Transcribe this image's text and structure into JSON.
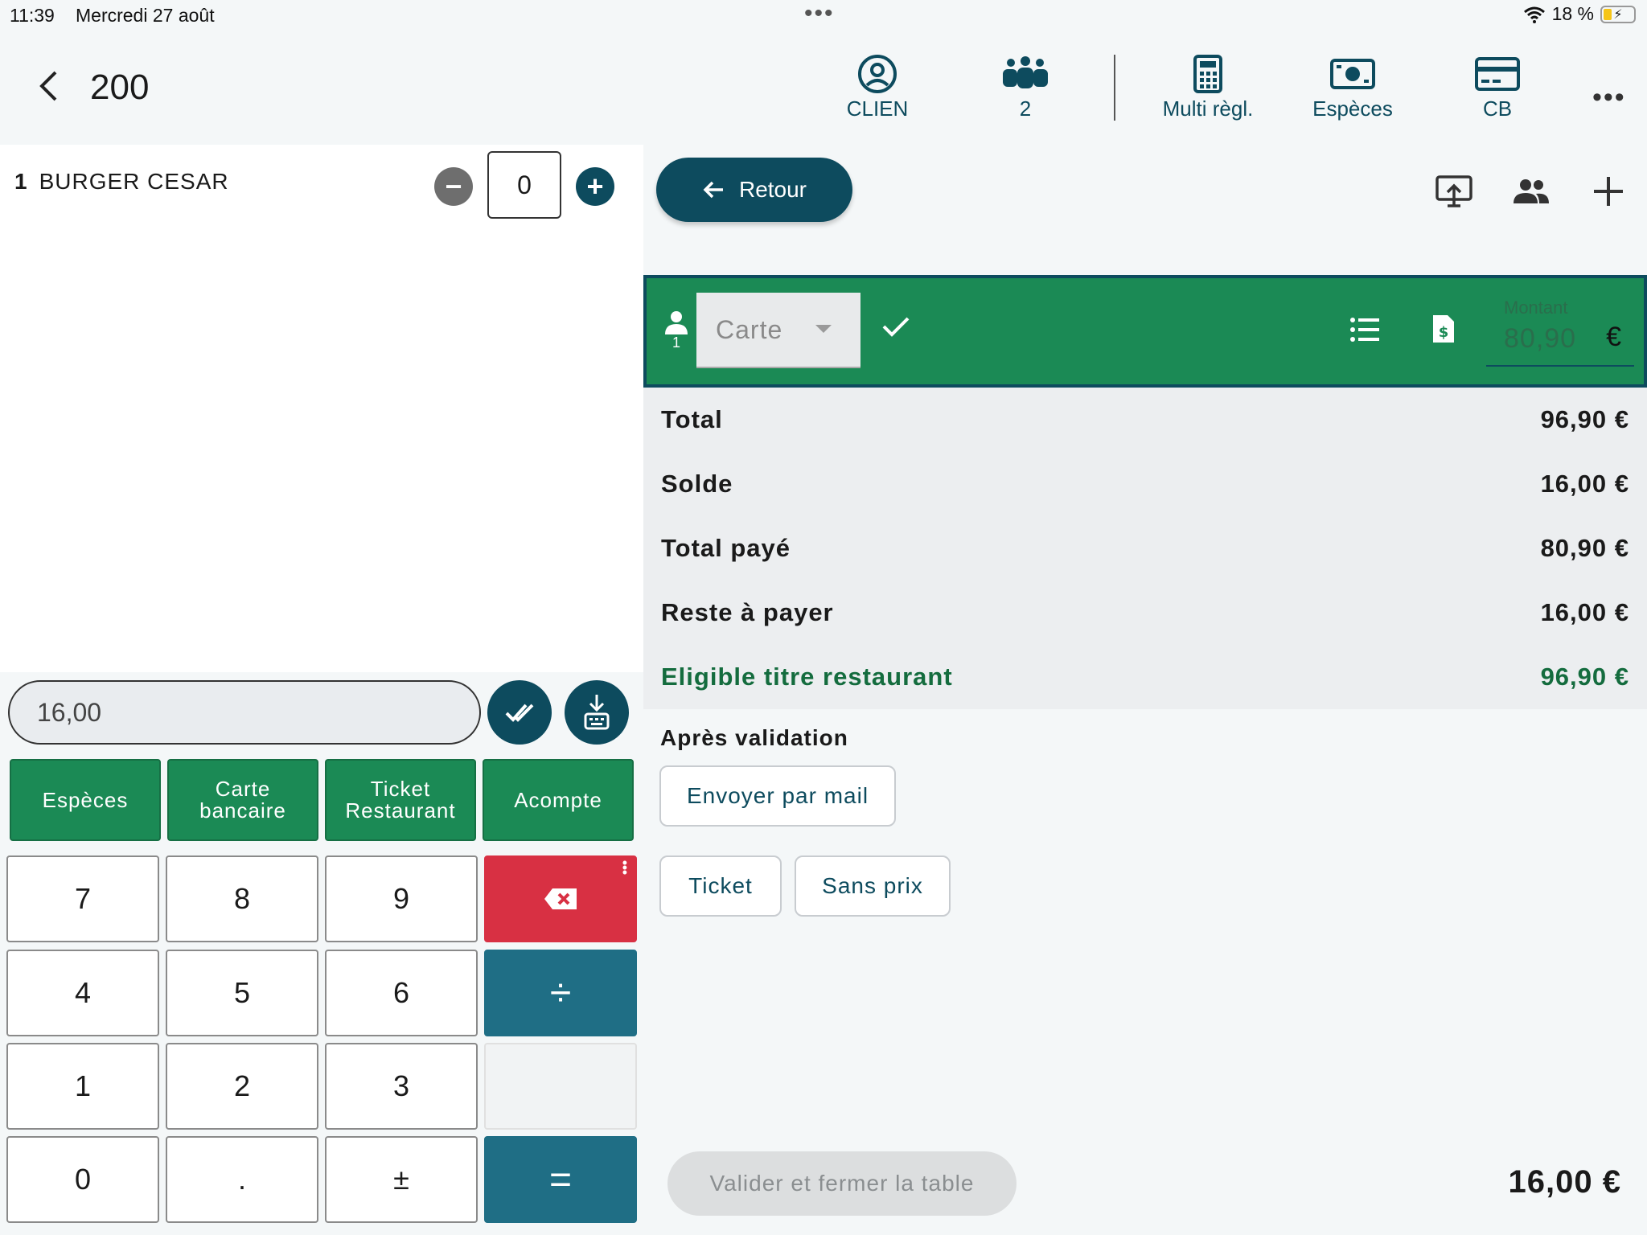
{
  "status_bar": {
    "time": "11:39",
    "date": "Mercredi 27 août",
    "battery": "18 %",
    "multitask_dots": "•••"
  },
  "header": {
    "table_number": "200",
    "actions": [
      {
        "label": "CLIEN",
        "icon": "user-circle-icon"
      },
      {
        "label": "2",
        "icon": "group-icon"
      },
      {
        "label": "Multi règl.",
        "icon": "calculator-icon"
      },
      {
        "label": "Espèces",
        "icon": "cash-icon"
      },
      {
        "label": "CB",
        "icon": "credit-card-icon"
      }
    ],
    "more": "•••"
  },
  "order": {
    "items": [
      {
        "qty": "1",
        "name": "BURGER CESAR",
        "quantity_value": "0"
      }
    ]
  },
  "keypad": {
    "amount": "16,00",
    "payment_buttons": [
      {
        "line1": "Espèces",
        "line2": ""
      },
      {
        "line1": "Carte",
        "line2": "bancaire"
      },
      {
        "line1": "Ticket",
        "line2": "Restaurant"
      },
      {
        "line1": "Acompte",
        "line2": ""
      }
    ],
    "keys": {
      "k7": "7",
      "k8": "8",
      "k9": "9",
      "k4": "4",
      "k5": "5",
      "k6": "6",
      "divide": "÷",
      "k1": "1",
      "k2": "2",
      "k3": "3",
      "k0": "0",
      "dot": ".",
      "plusminus": "±",
      "equals": "="
    }
  },
  "payment": {
    "retour_label": "Retour",
    "person_count": "1",
    "method": "Carte",
    "montant_label": "Montant",
    "montant_value": "80,90",
    "currency": "€"
  },
  "summary": {
    "rows": [
      {
        "label": "Total",
        "value": "96,90 €"
      },
      {
        "label": "Solde",
        "value": "16,00 €"
      },
      {
        "label": "Total payé",
        "value": "80,90 €"
      },
      {
        "label": "Reste à payer",
        "value": "16,00 €"
      },
      {
        "label": "Eligible titre restaurant",
        "value": "96,90 €"
      }
    ]
  },
  "after_validation": {
    "title": "Après validation",
    "send_mail": "Envoyer par mail",
    "ticket": "Ticket",
    "sans_prix": "Sans prix"
  },
  "footer": {
    "validate_label": "Valider et fermer la table",
    "total": "16,00 €"
  },
  "colors": {
    "primary_teal": "#0d4b5e",
    "payment_green": "#1b8a55",
    "backspace_red": "#d83043",
    "operator_teal": "#1f6e85",
    "eligible_green": "#146c3e"
  }
}
